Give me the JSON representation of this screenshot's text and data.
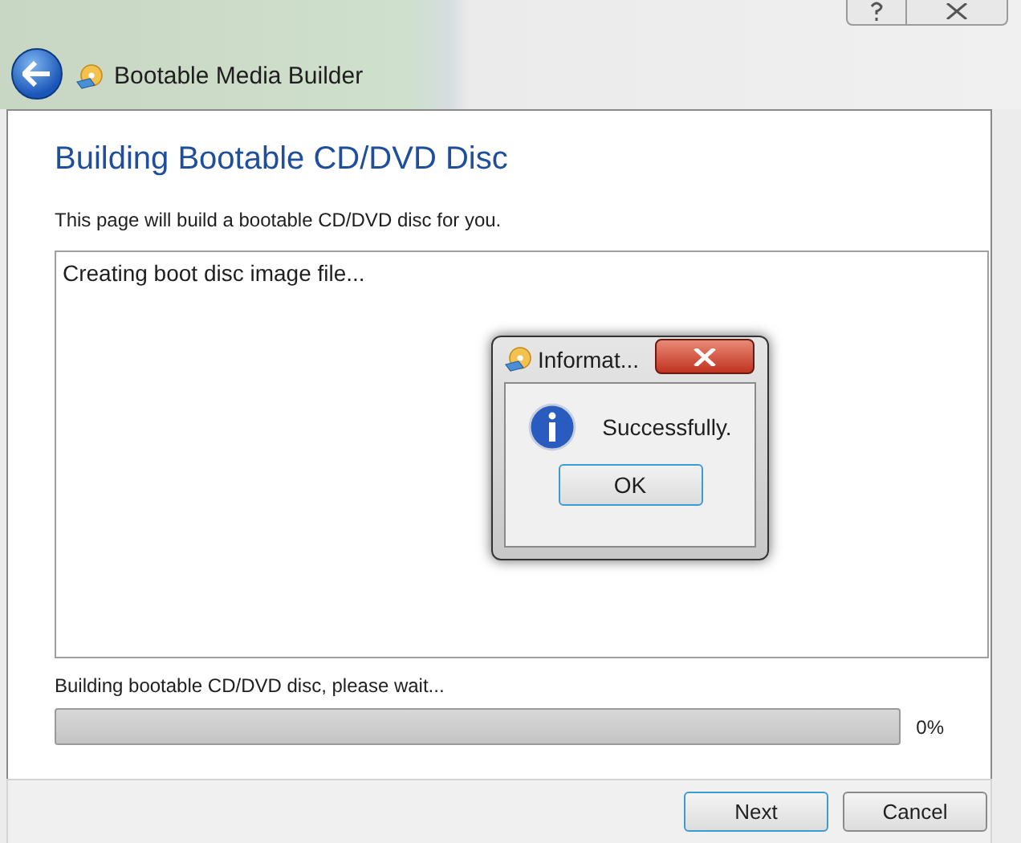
{
  "window": {
    "title": "Bootable Media Builder"
  },
  "page": {
    "heading": "Building Bootable CD/DVD Disc",
    "description": "This page will build a bootable CD/DVD disc for you."
  },
  "log": {
    "lines": [
      "Creating boot disc image file..."
    ]
  },
  "dialog": {
    "title": "Informat...",
    "message": "Successfully.",
    "button": "OK"
  },
  "progress": {
    "label": "Building bootable CD/DVD disc, please wait...",
    "level": 0,
    "reading": "0%"
  },
  "buttons": [
    {
      "label": "Next",
      "default": true
    },
    {
      "label": "Cancel",
      "default": false
    }
  ]
}
